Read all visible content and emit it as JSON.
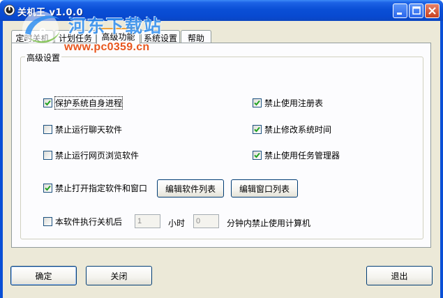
{
  "window": {
    "title": "关机王 v1.0.0",
    "controls": {
      "minimize": "minimize-icon",
      "maximize": "maximize-icon",
      "close": "close-icon"
    }
  },
  "watermark": {
    "site_name": "河东下载站",
    "url": "www.pc0359.cn"
  },
  "tabs": [
    {
      "label": "定时关机",
      "active": false
    },
    {
      "label": "计划任务",
      "active": false
    },
    {
      "label": "高级功能",
      "active": true
    },
    {
      "label": "系统设置",
      "active": false
    },
    {
      "label": "帮助",
      "active": false
    }
  ],
  "group": {
    "title": "高级设置",
    "options": {
      "protect_process": {
        "label": "保护系统自身进程",
        "checked": true
      },
      "block_chat": {
        "label": "禁止运行聊天软件",
        "checked": false
      },
      "block_browser": {
        "label": "禁止运行网页浏览软件",
        "checked": false
      },
      "block_specified": {
        "label": "禁止打开指定软件和窗口",
        "checked": true
      },
      "block_registry": {
        "label": "禁止使用注册表",
        "checked": true
      },
      "block_time_change": {
        "label": "禁止修改系统时间",
        "checked": true
      },
      "block_taskmgr": {
        "label": "禁止使用任务管理器",
        "checked": true
      },
      "after_shutdown": {
        "label": "本软件执行关机后",
        "checked": false
      }
    },
    "edit_software_list": "编辑软件列表",
    "edit_window_list": "编辑窗口列表",
    "hours_value": "1",
    "hours_unit": "小时",
    "minutes_value": "0",
    "minutes_suffix": "分钟内禁止使用计算机"
  },
  "footer": {
    "ok": "确定",
    "close": "关闭",
    "exit": "退出"
  },
  "colors": {
    "title_bar": "#0a4fd6",
    "dialog_bg": "#ece9d8",
    "tab_bg": "#fcfcfe",
    "check": "#21a121",
    "active_tab_accent": "#f0a33b"
  }
}
